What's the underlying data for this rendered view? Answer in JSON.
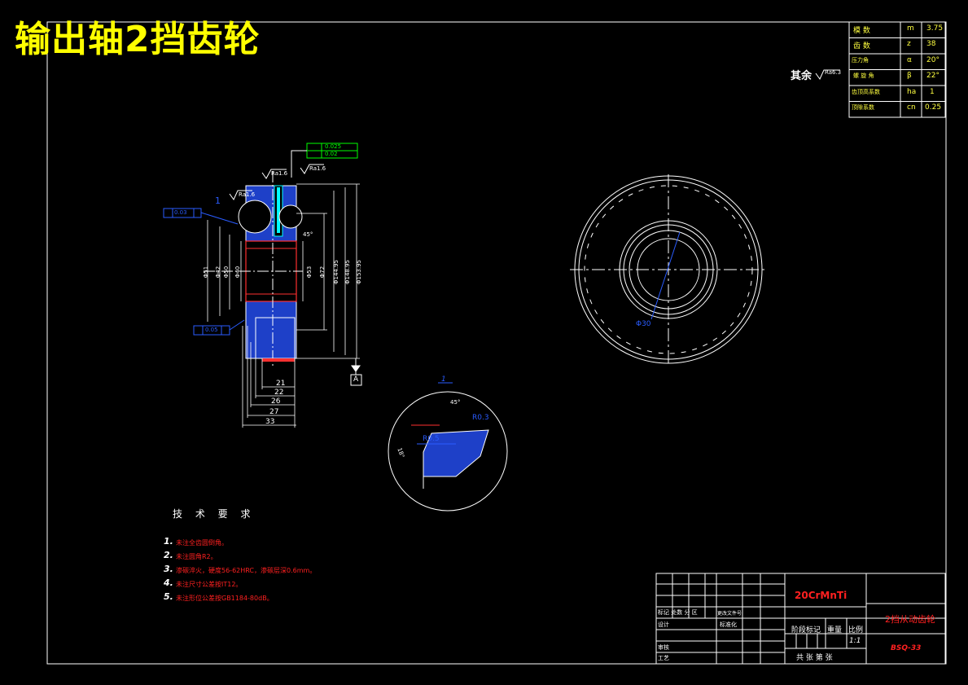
{
  "title": "输出轴2挡齿轮",
  "roughness_note": {
    "prefix": "其余",
    "value": "Ra6.3"
  },
  "param_table": [
    {
      "name": "模 数",
      "symbol": "m",
      "value": "3.75"
    },
    {
      "name": "齿 数",
      "symbol": "z",
      "value": "38"
    },
    {
      "name": "压力角",
      "symbol": "α",
      "value": "20°"
    },
    {
      "name": "螺 旋 角",
      "symbol": "β",
      "value": "22°"
    },
    {
      "name": "齿顶高系数",
      "symbol": "ha",
      "value": "1"
    },
    {
      "name": "顶隙系数",
      "symbol": "cn",
      "value": "0.25"
    }
  ],
  "section_labels": {
    "roughness": [
      "Ra1.6",
      "Ra1.6",
      "Ra1.6"
    ],
    "tolerance_top": [
      "0.025",
      "0.02"
    ],
    "tolerance_left": "0.03",
    "tolerance_bottom": "0.05",
    "datum": "A",
    "dims_vertical": [
      "Φ51",
      "Φ42",
      "Φ50",
      "Φ40",
      "Φ53",
      "Φ72",
      "Φ144.95",
      "Φ148.95",
      "Φ153.95"
    ],
    "dims_horizontal": [
      "21",
      "22",
      "26",
      "27",
      "33"
    ],
    "chamfer": "45°",
    "leader": "1"
  },
  "detail_view": {
    "label": "1",
    "labels": [
      "45°",
      "R0.3",
      "R0.5",
      "18°"
    ]
  },
  "circle_view": {
    "dim": "Φ30"
  },
  "requirements": {
    "title": "技 术 要 求",
    "items": [
      "未注全齿圆倒角。",
      "未注圆角R2。",
      "渗碳淬火，硬度56-62HRC，渗碳层深0.6mm。",
      "未注尺寸公差按IT12。",
      "未注形位公差按GB1184-80dB。"
    ]
  },
  "title_block": {
    "material": "20CrMnTi",
    "part_name": "2挡从动齿轮",
    "drawing_no": "BSQ-33",
    "scale": "1:1",
    "labels": {
      "marks": "标记 处数 分 区",
      "file_no": "更改文件号",
      "design": "设计",
      "standard": "标准化",
      "stage": "阶段标记",
      "weight": "重量",
      "scale_label": "比例",
      "check": "审核",
      "process": "工艺",
      "sheets": "共 张  第 张"
    }
  }
}
